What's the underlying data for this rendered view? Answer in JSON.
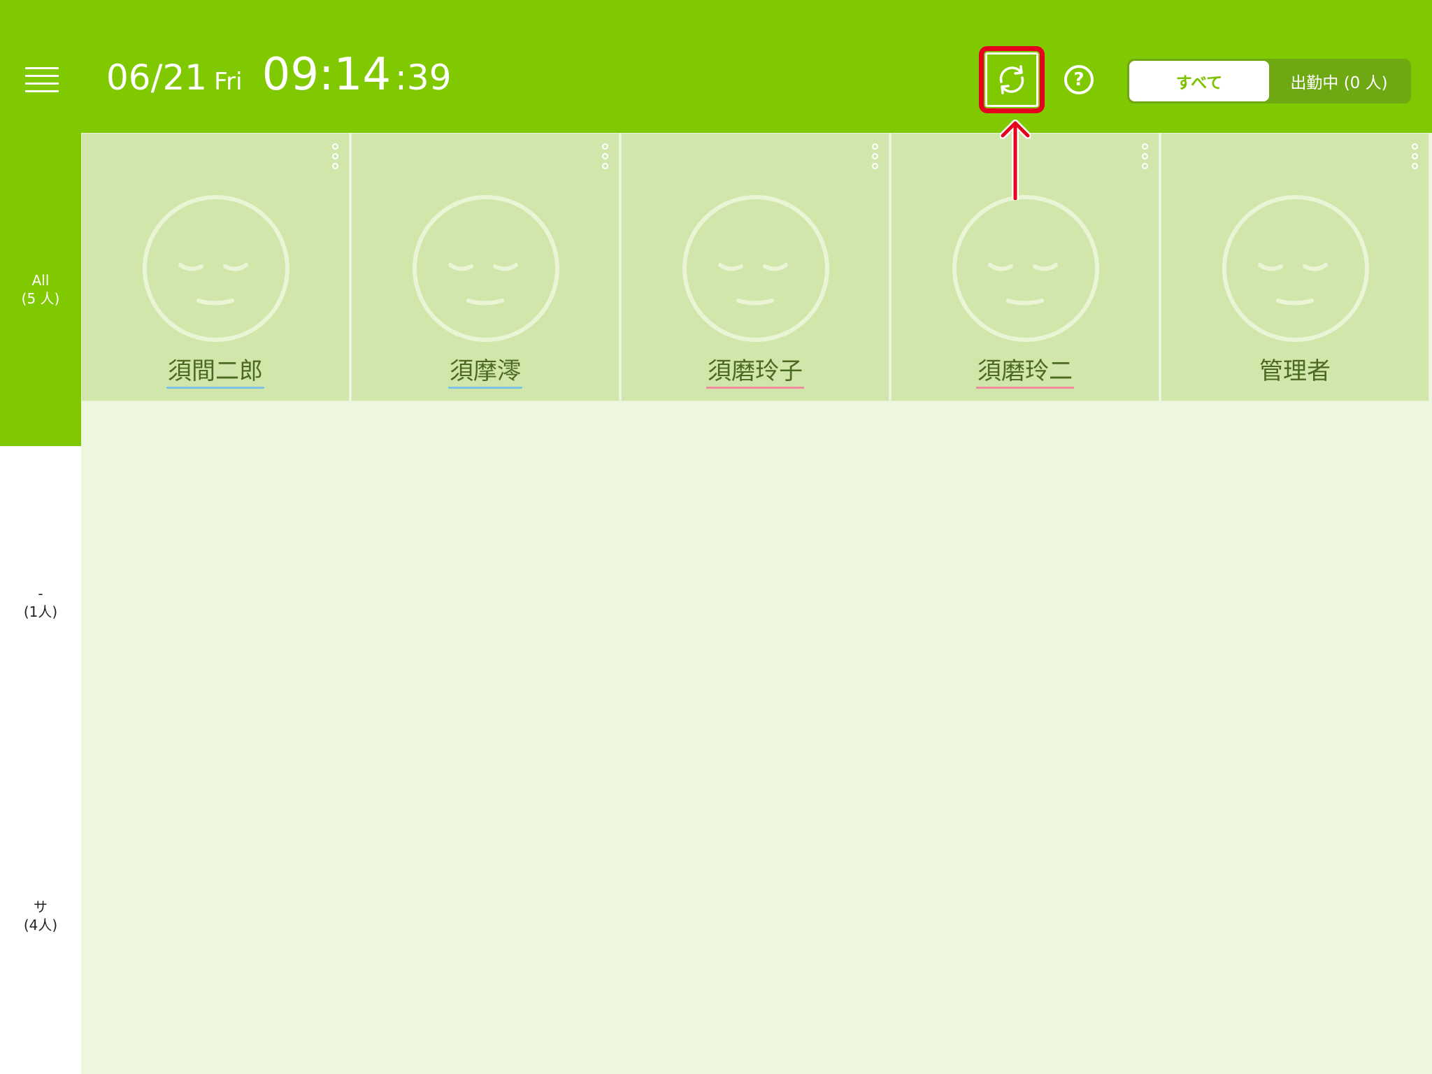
{
  "header": {
    "date": "06/21",
    "weekday": "Fri",
    "time": "09:14",
    "seconds": ":39"
  },
  "filter": {
    "all_label": "すべて",
    "working_label": "出勤中 (0 人)",
    "selected": "all"
  },
  "sidebar": {
    "items": [
      {
        "label": "All",
        "count": "(5 人)",
        "active": true
      },
      {
        "label": "-",
        "count": "(1人)",
        "active": false
      },
      {
        "label": "サ",
        "count": "(4人)",
        "active": false
      }
    ]
  },
  "staff": [
    {
      "name": "須間二郎",
      "underline": "blue"
    },
    {
      "name": "須摩澪",
      "underline": "blue"
    },
    {
      "name": "須磨玲子",
      "underline": "pink"
    },
    {
      "name": "須磨玲二",
      "underline": "pink"
    },
    {
      "name": "管理者",
      "underline": "none"
    }
  ],
  "icons": {
    "menu": "hamburger-menu-icon",
    "refresh": "refresh-icon",
    "help": "help-icon",
    "card_menu": "more-vertical-icon",
    "face": "sleeping-face-icon"
  },
  "colors": {
    "brand_green": "#80c800",
    "card_bg": "#d1e6aa",
    "main_bg": "#edf6de",
    "highlight_red": "#e6001e",
    "underline_blue": "#7ec3e6",
    "underline_pink": "#ef8c9e"
  }
}
